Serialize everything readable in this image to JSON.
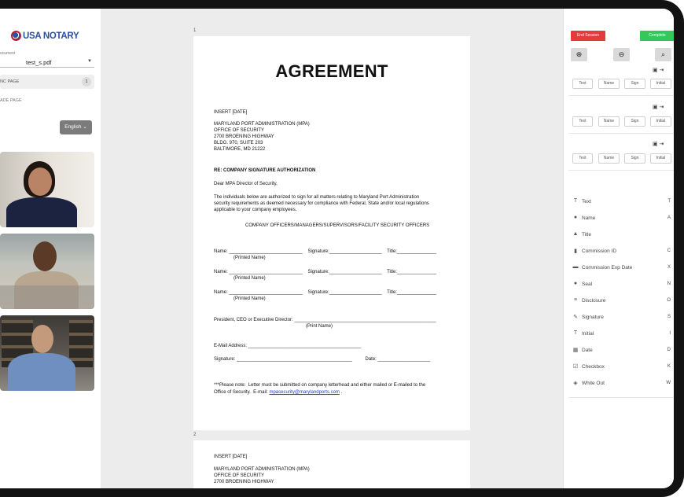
{
  "sidebar": {
    "logo_text": "USA NOTARY",
    "doc_label": "ocument",
    "doc_value": "test_s.pdf",
    "sync_label": "NC PAGE",
    "sync_count": "1",
    "add_page": "ADE PAGE",
    "language": "English ⌄"
  },
  "viewer": {
    "page1_num": "1",
    "page2_num": "2",
    "doc": {
      "title": "AGREEMENT",
      "insert_date": "INSERT [DATE]",
      "addr1": "MARYLAND PORT ADMINISTRATION (MPA)",
      "addr2": "OFFICE OF SECURITY",
      "addr3": "2700 BROENING HIGHWAY",
      "addr4": "BLDG. 970, SUITE 203",
      "addr5": "BALTIMORE, MD 21222",
      "re": "RE: COMPANY SIGNATURE AUTHORIZATION",
      "dear": "Dear MPA Director of Security,",
      "para1": "The individuals below are authorized to sign for all matters relating to Maryland Port Administration",
      "para2": "security requirements as deemed necessary for compliance with Federal, State and/or local regulations",
      "para3": "applicable to your company employees.",
      "officers": "COMPANY OFFICERS/MANAGERS/SUPERVISORS/FACILITY SECURITY OFFICERS",
      "name_line": "Name: ____________________________    Signature:____________________    Title:_______________",
      "printed_name": "(Printed Name)",
      "president": "President, CEO or Executive Director: ______________________________________________________",
      "print_name": "(Print Name)",
      "email_line": "E-Mail Address: ___________________________________________",
      "sig_line": "Signature: ____________________________________________          Date: ____________________",
      "note1": "***Please note:  Letter must be submitted on company letterhead and either mailed or E-mailed to the",
      "note2_pre": "Office of Security.  E-mail: ",
      "note2_link": "mpasecurity@marylandports.com",
      "note2_post": " .",
      "p2_insert": "INSERT [DATE]",
      "p2_addr1": "MARYLAND PORT ADMINISTRATION (MPA)",
      "p2_addr2": "OFFICE OF SECURITY",
      "p2_addr3": "2700 BROENING HIGHWAY"
    }
  },
  "right": {
    "end_session": "End Session",
    "complete": "Complete",
    "zoom_in": "⊕",
    "zoom_out": "⊖",
    "zoom_reset": "⌕",
    "sig_buttons": [
      "Text",
      "Name",
      "Sign",
      "Initial"
    ],
    "sig_icons": "▣ ⇥",
    "fields": [
      {
        "icon": "T",
        "name": "Text",
        "key": "T"
      },
      {
        "icon": "●",
        "name": "Name",
        "key": "A"
      },
      {
        "icon": "▲",
        "name": "Title",
        "key": ""
      },
      {
        "icon": "▮",
        "name": "Commission ID",
        "key": "C"
      },
      {
        "icon": "▬",
        "name": "Commission Exp Date",
        "key": "X"
      },
      {
        "icon": "●",
        "name": "Seal",
        "key": "N"
      },
      {
        "icon": "≡",
        "name": "Disclosure",
        "key": "O"
      },
      {
        "icon": "✎",
        "name": "Signature",
        "key": "S"
      },
      {
        "icon": "T",
        "name": "Initial",
        "key": "I"
      },
      {
        "icon": "▦",
        "name": "Date",
        "key": "D"
      },
      {
        "icon": "☑",
        "name": "Checkbox",
        "key": "K"
      },
      {
        "icon": "◈",
        "name": "White Out",
        "key": "W"
      }
    ]
  }
}
